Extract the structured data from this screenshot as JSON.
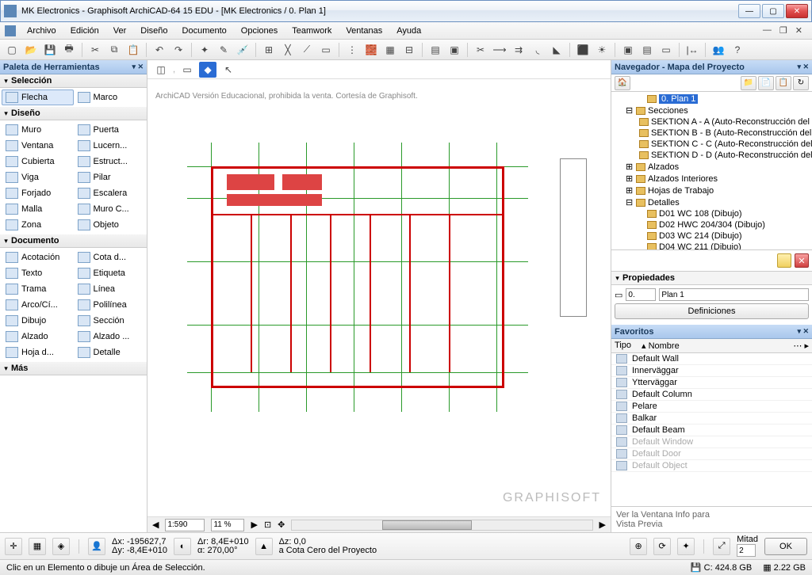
{
  "title": "MK Electronics - Graphisoft ArchiCAD-64 15 EDU - [MK Electronics / 0. Plan 1]",
  "menus": [
    "Archivo",
    "Edición",
    "Ver",
    "Diseño",
    "Documento",
    "Opciones",
    "Teamwork",
    "Ventanas",
    "Ayuda"
  ],
  "palette": {
    "title": "Paleta de Herramientas",
    "sections": {
      "seleccion": {
        "label": "Selección",
        "tools": [
          [
            "Flecha",
            "Marco"
          ]
        ]
      },
      "diseno": {
        "label": "Diseño",
        "tools": [
          [
            "Muro",
            "Puerta"
          ],
          [
            "Ventana",
            "Lucern..."
          ],
          [
            "Cubierta",
            "Estruct..."
          ],
          [
            "Viga",
            "Pilar"
          ],
          [
            "Forjado",
            "Escalera"
          ],
          [
            "Malla",
            "Muro C..."
          ],
          [
            "Zona",
            "Objeto"
          ]
        ]
      },
      "documento": {
        "label": "Documento",
        "tools": [
          [
            "Acotación",
            "Cota d..."
          ],
          [
            "Texto",
            "Etiqueta"
          ],
          [
            "Trama",
            "Línea"
          ],
          [
            "Arco/Cí...",
            "Polilínea"
          ],
          [
            "Dibujo",
            "Sección"
          ],
          [
            "Alzado",
            "Alzado ..."
          ],
          [
            "Hoja d...",
            "Detalle"
          ]
        ]
      },
      "mas": {
        "label": "Más"
      }
    }
  },
  "canvas": {
    "edu_text": "ArchiCAD Versión Educacional, prohibida la venta. Cortesía de Graphisoft.",
    "brand": "GRAPHISOFT",
    "zoom_pct": "11 %",
    "zoom_ratio": "1:590"
  },
  "navigator": {
    "title": "Navegador - Mapa del Proyecto",
    "items": [
      {
        "l": 2,
        "t": "0. Plan 1",
        "sel": true
      },
      {
        "l": 1,
        "t": "Secciones",
        "exp": true
      },
      {
        "l": 2,
        "t": "SEKTION A - A (Auto-Reconstrucción del"
      },
      {
        "l": 2,
        "t": "SEKTION B - B (Auto-Reconstrucción del"
      },
      {
        "l": 2,
        "t": "SEKTION C - C (Auto-Reconstrucción del"
      },
      {
        "l": 2,
        "t": "SEKTION D - D (Auto-Reconstrucción del"
      },
      {
        "l": 1,
        "t": "Alzados"
      },
      {
        "l": 1,
        "t": "Alzados Interiores"
      },
      {
        "l": 1,
        "t": "Hojas de Trabajo"
      },
      {
        "l": 1,
        "t": "Detalles",
        "exp": true
      },
      {
        "l": 2,
        "t": "D01 WC 108 (Dibujo)"
      },
      {
        "l": 2,
        "t": "D02 HWC 204/304 (Dibujo)"
      },
      {
        "l": 2,
        "t": "D03 WC 214 (Dibujo)"
      },
      {
        "l": 2,
        "t": "D04 WC 211 (Dibujo)"
      }
    ]
  },
  "properties": {
    "title": "Propiedades",
    "id": "0.",
    "name": "Plan 1",
    "btn": "Definiciones"
  },
  "favorites": {
    "title": "Favoritos",
    "col_type": "Tipo",
    "col_name": "Nombre",
    "items": [
      {
        "n": "Default Wall"
      },
      {
        "n": "Innerväggar"
      },
      {
        "n": "Ytterväggar"
      },
      {
        "n": "Default Column"
      },
      {
        "n": "Pelare"
      },
      {
        "n": "Balkar"
      },
      {
        "n": "Default Beam"
      },
      {
        "n": "Default Window",
        "dim": true
      },
      {
        "n": "Default Door",
        "dim": true
      },
      {
        "n": "Default Object",
        "dim": true
      }
    ],
    "footer": "Ver la Ventana Info para\nVista Previa"
  },
  "info": {
    "dx": "Δx: -195627,7",
    "dy": "Δy: -8,4E+010",
    "dr": "Δr: 8,4E+010",
    "da": "α: 270,00°",
    "dz": "Δz: 0,0",
    "cota": "a Cota Cero del Proyecto",
    "mitad": "Mitad",
    "mitad_val": "2",
    "ok": "OK"
  },
  "status": {
    "hint": "Clic en un Elemento o dibuje un Área de Selección.",
    "drive": "C: 424.8 GB",
    "mem": "2.22 GB"
  }
}
